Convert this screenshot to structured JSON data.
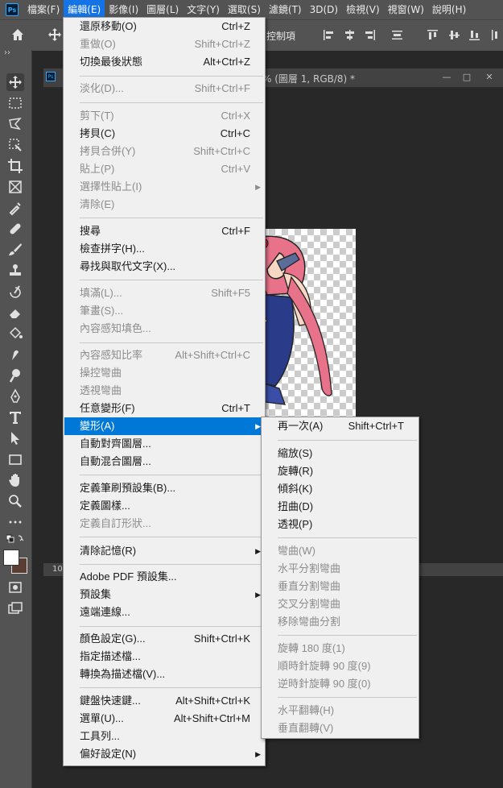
{
  "menubar": {
    "logo": "Ps",
    "items": [
      "檔案(F)",
      "編輯(E)",
      "影像(I)",
      "圖層(L)",
      "文字(Y)",
      "選取(S)",
      "濾鏡(T)",
      "3D(D)",
      "檢視(V)",
      "視窗(W)",
      "說明(H)"
    ]
  },
  "optionsbar": {
    "control_label": "控制項"
  },
  "document": {
    "tab_icon": "Ps",
    "title": "% (圖層 1, RGB/8) *",
    "status": "10"
  },
  "edit_menu": {
    "items": [
      {
        "label": "還原移動(O)",
        "shortcut": "Ctrl+Z",
        "disabled": false
      },
      {
        "label": "重做(O)",
        "shortcut": "Shift+Ctrl+Z",
        "disabled": true
      },
      {
        "label": "切換最後狀態",
        "shortcut": "Alt+Ctrl+Z",
        "disabled": false
      },
      {
        "label": "淡化(D)...",
        "shortcut": "Shift+Ctrl+F",
        "disabled": true
      },
      {
        "label": "剪下(T)",
        "shortcut": "Ctrl+X",
        "disabled": true
      },
      {
        "label": "拷貝(C)",
        "shortcut": "Ctrl+C",
        "disabled": false
      },
      {
        "label": "拷貝合併(Y)",
        "shortcut": "Shift+Ctrl+C",
        "disabled": true
      },
      {
        "label": "貼上(P)",
        "shortcut": "Ctrl+V",
        "disabled": true
      },
      {
        "label": "選擇性貼上(I)",
        "shortcut": "",
        "disabled": true
      },
      {
        "label": "清除(E)",
        "shortcut": "",
        "disabled": true
      },
      {
        "label": "搜尋",
        "shortcut": "Ctrl+F",
        "disabled": false
      },
      {
        "label": "檢查拼字(H)...",
        "shortcut": "",
        "disabled": false
      },
      {
        "label": "尋找與取代文字(X)...",
        "shortcut": "",
        "disabled": false
      },
      {
        "label": "填滿(L)...",
        "shortcut": "Shift+F5",
        "disabled": true
      },
      {
        "label": "筆畫(S)...",
        "shortcut": "",
        "disabled": true
      },
      {
        "label": "內容感知填色...",
        "shortcut": "",
        "disabled": true
      },
      {
        "label": "內容感知比率",
        "shortcut": "Alt+Shift+Ctrl+C",
        "disabled": true
      },
      {
        "label": "操控彎曲",
        "shortcut": "",
        "disabled": true
      },
      {
        "label": "透視彎曲",
        "shortcut": "",
        "disabled": true
      },
      {
        "label": "任意變形(F)",
        "shortcut": "Ctrl+T",
        "disabled": false
      },
      {
        "label": "變形(A)",
        "shortcut": "",
        "disabled": false
      },
      {
        "label": "自動對齊圖層...",
        "shortcut": "",
        "disabled": false
      },
      {
        "label": "自動混合圖層...",
        "shortcut": "",
        "disabled": false
      },
      {
        "label": "定義筆刷預設集(B)...",
        "shortcut": "",
        "disabled": false
      },
      {
        "label": "定義圖樣...",
        "shortcut": "",
        "disabled": false
      },
      {
        "label": "定義自訂形狀...",
        "shortcut": "",
        "disabled": true
      },
      {
        "label": "清除記憶(R)",
        "shortcut": "",
        "disabled": false
      },
      {
        "label": "Adobe PDF 預設集...",
        "shortcut": "",
        "disabled": false
      },
      {
        "label": "預設集",
        "shortcut": "",
        "disabled": false
      },
      {
        "label": "遠端連線...",
        "shortcut": "",
        "disabled": false
      },
      {
        "label": "顏色設定(G)...",
        "shortcut": "Shift+Ctrl+K",
        "disabled": false
      },
      {
        "label": "指定描述檔...",
        "shortcut": "",
        "disabled": false
      },
      {
        "label": "轉換為描述檔(V)...",
        "shortcut": "",
        "disabled": false
      },
      {
        "label": "鍵盤快速鍵...",
        "shortcut": "Alt+Shift+Ctrl+K",
        "disabled": false
      },
      {
        "label": "選單(U)...",
        "shortcut": "Alt+Shift+Ctrl+M",
        "disabled": false
      },
      {
        "label": "工具列...",
        "shortcut": "",
        "disabled": false
      },
      {
        "label": "偏好設定(N)",
        "shortcut": "",
        "disabled": false
      }
    ]
  },
  "transform_menu": {
    "items": [
      {
        "label": "再一次(A)",
        "shortcut": "Shift+Ctrl+T",
        "disabled": false
      },
      {
        "label": "縮放(S)",
        "shortcut": "",
        "disabled": false
      },
      {
        "label": "旋轉(R)",
        "shortcut": "",
        "disabled": false
      },
      {
        "label": "傾斜(K)",
        "shortcut": "",
        "disabled": false
      },
      {
        "label": "扭曲(D)",
        "shortcut": "",
        "disabled": false
      },
      {
        "label": "透視(P)",
        "shortcut": "",
        "disabled": false
      },
      {
        "label": "彎曲(W)",
        "shortcut": "",
        "disabled": true
      },
      {
        "label": "水平分割彎曲",
        "shortcut": "",
        "disabled": true
      },
      {
        "label": "垂直分割彎曲",
        "shortcut": "",
        "disabled": true
      },
      {
        "label": "交叉分割彎曲",
        "shortcut": "",
        "disabled": true
      },
      {
        "label": "移除彎曲分割",
        "shortcut": "",
        "disabled": true
      },
      {
        "label": "旋轉 180 度(1)",
        "shortcut": "",
        "disabled": true
      },
      {
        "label": "順時針旋轉 90 度(9)",
        "shortcut": "",
        "disabled": true
      },
      {
        "label": "逆時針旋轉 90 度(0)",
        "shortcut": "",
        "disabled": true
      },
      {
        "label": "水平翻轉(H)",
        "shortcut": "",
        "disabled": true
      },
      {
        "label": "垂直翻轉(V)",
        "shortcut": "",
        "disabled": true
      }
    ]
  },
  "colors": {
    "highlight": "#0078d7",
    "menubar_active": "#1473e6",
    "ui_bg": "#535353",
    "workspace": "#282828"
  }
}
